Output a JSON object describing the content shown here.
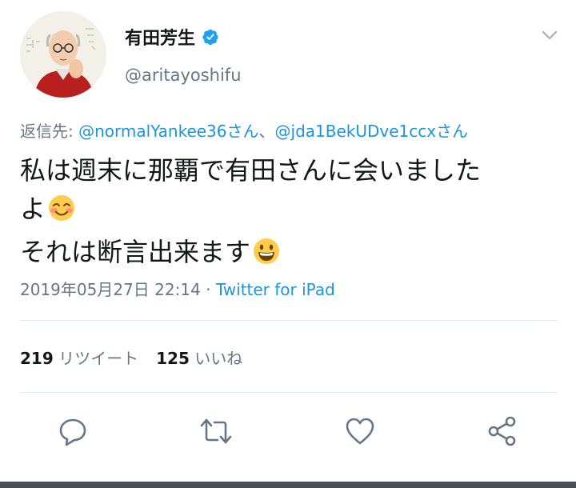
{
  "author": {
    "display_name": "有田芳生",
    "handle": "@aritayoshifu",
    "verified": true
  },
  "reply": {
    "prefix": "返信先: ",
    "mention1": "@normalYankee36さん",
    "separator": "、",
    "mention2": "@jda1BekUDve1ccxさん"
  },
  "text": {
    "line1": "私は週末に那覇で有田さんに会いました",
    "line2": "よ",
    "line2_emoji": "smiling-face-with-blush",
    "line3": "それは断言出来ます",
    "line3_emoji": "grinning-face"
  },
  "meta": {
    "timestamp": "2019年05月27日 22:14",
    "dot": " · ",
    "source": "Twitter for iPad"
  },
  "stats": {
    "retweets_count": "219",
    "retweets_label": "リツイート",
    "likes_count": "125",
    "likes_label": "いいね"
  },
  "colors": {
    "link": "#1b95e0",
    "secondary": "#657786",
    "primary": "#14171a",
    "divider": "#e1e8ed"
  },
  "icons": {
    "reply": "reply-icon",
    "retweet": "retweet-icon",
    "like": "heart-icon",
    "share": "share-icon",
    "menu": "chevron-down-icon",
    "verified": "verified-badge-icon"
  }
}
